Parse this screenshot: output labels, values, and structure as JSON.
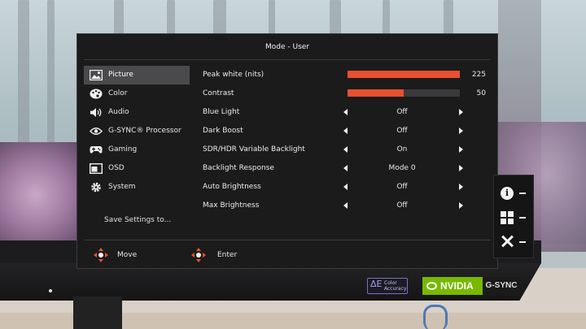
{
  "osd": {
    "title": "Mode - User",
    "menu": [
      {
        "label": "Picture",
        "icon": "picture-icon",
        "active": true
      },
      {
        "label": "Color",
        "icon": "palette-icon",
        "active": false
      },
      {
        "label": "Audio",
        "icon": "speaker-icon",
        "active": false
      },
      {
        "label": "G-SYNC® Processor",
        "icon": "nvidia-eye-icon",
        "active": false
      },
      {
        "label": "Gaming",
        "icon": "gamepad-icon",
        "active": false
      },
      {
        "label": "OSD",
        "icon": "osd-window-icon",
        "active": false
      },
      {
        "label": "System",
        "icon": "gear-icon",
        "active": false
      }
    ],
    "save_label": "Save Settings to...",
    "settings": [
      {
        "label": "Peak white (nits)",
        "type": "slider",
        "value": "225",
        "fill": 1.0
      },
      {
        "label": "Contrast",
        "type": "slider",
        "value": "50",
        "fill": 0.5
      },
      {
        "label": "Blue Light",
        "type": "option",
        "value": "Off"
      },
      {
        "label": "Dark Boost",
        "type": "option",
        "value": "Off"
      },
      {
        "label": "SDR/HDR Variable Backlight",
        "type": "option",
        "value": "On"
      },
      {
        "label": "Backlight Response",
        "type": "option",
        "value": "Mode 0"
      },
      {
        "label": "Auto Brightness",
        "type": "option",
        "value": "Off"
      },
      {
        "label": "Max Brightness",
        "type": "option",
        "value": "Off"
      }
    ],
    "footer": {
      "move_label": "Move",
      "enter_label": "Enter"
    },
    "accent_color": "#e8502e"
  },
  "hotkeys": [
    {
      "icon": "info-icon"
    },
    {
      "icon": "grid-icon"
    },
    {
      "icon": "close-icon"
    }
  ],
  "badges": {
    "delta_symbol": "ΔE",
    "delta_text": "Color Accuracy",
    "nvidia": "NVIDIA",
    "gsync": "G-SYNC"
  }
}
